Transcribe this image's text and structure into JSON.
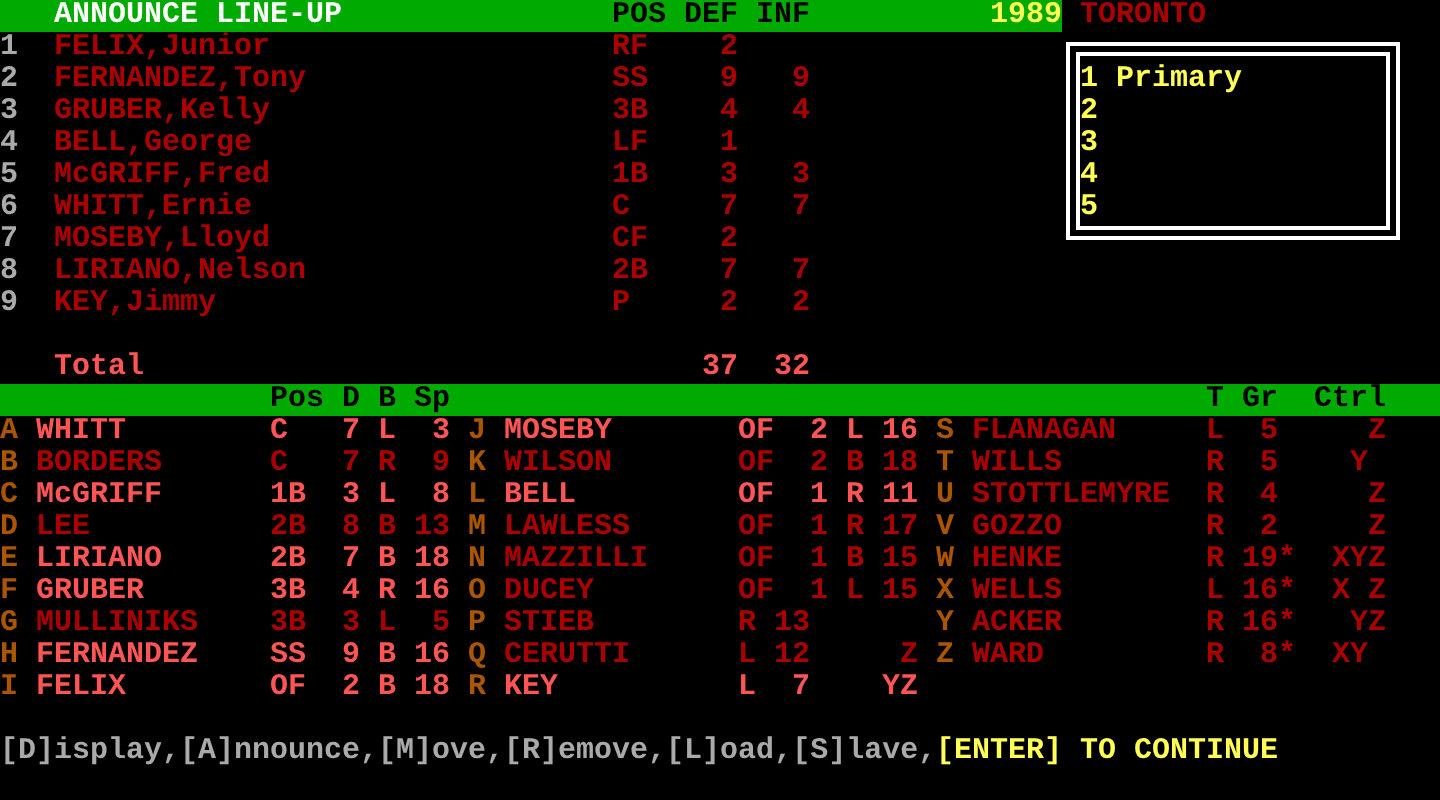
{
  "header": {
    "title": "ANNOUNCE LINE-UP",
    "columns": [
      "POS",
      "DEF",
      "INF"
    ],
    "year": "1989",
    "team": "TORONTO"
  },
  "lineup": [
    {
      "order": "1",
      "name": "FELIX,Junior",
      "pos": "RF",
      "def": "2"
    },
    {
      "order": "2",
      "name": "FERNANDEZ,Tony",
      "pos": "SS",
      "def": "9",
      "inf": "9"
    },
    {
      "order": "3",
      "name": "GRUBER,Kelly",
      "pos": "3B",
      "def": "4",
      "inf": "4"
    },
    {
      "order": "4",
      "name": "BELL,George",
      "pos": "LF",
      "def": "1"
    },
    {
      "order": "5",
      "name": "McGRIFF,Fred",
      "pos": "1B",
      "def": "3",
      "inf": "3"
    },
    {
      "order": "6",
      "name": "WHITT,Ernie",
      "pos": "C",
      "def": "7",
      "inf": "7"
    },
    {
      "order": "7",
      "name": "MOSEBY,Lloyd",
      "pos": "CF",
      "def": "2"
    },
    {
      "order": "8",
      "name": "LIRIANO,Nelson",
      "pos": "2B",
      "def": "7",
      "inf": "7"
    },
    {
      "order": "9",
      "name": "KEY,Jimmy",
      "pos": "P",
      "def": "2",
      "inf": "2"
    }
  ],
  "total": {
    "label": "Total",
    "def": "37",
    "inf": "32"
  },
  "slots": [
    {
      "number": "1",
      "name": "Primary"
    },
    {
      "number": "2"
    },
    {
      "number": "3"
    },
    {
      "number": "4"
    },
    {
      "number": "5"
    }
  ],
  "roster_columns": [
    "Pos",
    "D",
    "B",
    "Sp",
    "T",
    "Gr",
    "Ctrl"
  ],
  "roster": [
    {
      "kind": "batter",
      "key": "A",
      "name": "WHITT",
      "pos": "C",
      "d": "7",
      "b": "L",
      "sp": "3",
      "in_lineup": true
    },
    {
      "kind": "batter",
      "key": "B",
      "name": "BORDERS",
      "pos": "C",
      "d": "7",
      "b": "R",
      "sp": "9",
      "in_lineup": false
    },
    {
      "kind": "batter",
      "key": "C",
      "name": "McGRIFF",
      "pos": "1B",
      "d": "3",
      "b": "L",
      "sp": "8",
      "in_lineup": true
    },
    {
      "kind": "batter",
      "key": "D",
      "name": "LEE",
      "pos": "2B",
      "d": "8",
      "b": "B",
      "sp": "13",
      "in_lineup": false
    },
    {
      "kind": "batter",
      "key": "E",
      "name": "LIRIANO",
      "pos": "2B",
      "d": "7",
      "b": "B",
      "sp": "18",
      "in_lineup": true
    },
    {
      "kind": "batter",
      "key": "F",
      "name": "GRUBER",
      "pos": "3B",
      "d": "4",
      "b": "R",
      "sp": "16",
      "in_lineup": true
    },
    {
      "kind": "batter",
      "key": "G",
      "name": "MULLINIKS",
      "pos": "3B",
      "d": "3",
      "b": "L",
      "sp": "5",
      "in_lineup": false
    },
    {
      "kind": "batter",
      "key": "H",
      "name": "FERNANDEZ",
      "pos": "SS",
      "d": "9",
      "b": "B",
      "sp": "16",
      "in_lineup": true
    },
    {
      "kind": "batter",
      "key": "I",
      "name": "FELIX",
      "pos": "OF",
      "d": "2",
      "b": "B",
      "sp": "18",
      "in_lineup": true
    },
    {
      "kind": "batter",
      "key": "J",
      "name": "MOSEBY",
      "pos": "OF",
      "d": "2",
      "b": "L",
      "sp": "16",
      "in_lineup": true
    },
    {
      "kind": "batter",
      "key": "K",
      "name": "WILSON",
      "pos": "OF",
      "d": "2",
      "b": "B",
      "sp": "18",
      "in_lineup": false
    },
    {
      "kind": "batter",
      "key": "L",
      "name": "BELL",
      "pos": "OF",
      "d": "1",
      "b": "R",
      "sp": "11",
      "in_lineup": true
    },
    {
      "kind": "batter",
      "key": "M",
      "name": "LAWLESS",
      "pos": "OF",
      "d": "1",
      "b": "R",
      "sp": "17",
      "in_lineup": false
    },
    {
      "kind": "batter",
      "key": "N",
      "name": "MAZZILLI",
      "pos": "OF",
      "d": "1",
      "b": "B",
      "sp": "15",
      "in_lineup": false
    },
    {
      "kind": "batter",
      "key": "O",
      "name": "DUCEY",
      "pos": "OF",
      "d": "1",
      "b": "L",
      "sp": "15",
      "in_lineup": false
    },
    {
      "kind": "pitcher",
      "key": "P",
      "name": "STIEB",
      "t": "R",
      "gr": "13",
      "in_lineup": false
    },
    {
      "kind": "pitcher",
      "key": "Q",
      "name": "CERUTTI",
      "t": "L",
      "gr": "12",
      "ctrl": "  Z",
      "in_lineup": false
    },
    {
      "kind": "pitcher",
      "key": "R",
      "name": "KEY",
      "t": "L",
      "gr": "7",
      "ctrl": " YZ",
      "in_lineup": true
    },
    {
      "kind": "pitcher",
      "key": "S",
      "name": "FLANAGAN",
      "t": "L",
      "gr": "5",
      "ctrl": "  Z",
      "in_lineup": false
    },
    {
      "kind": "pitcher",
      "key": "T",
      "name": "WILLS",
      "t": "R",
      "gr": "5",
      "ctrl": " Y ",
      "in_lineup": false
    },
    {
      "kind": "pitcher",
      "key": "U",
      "name": "STOTTLEMYRE",
      "t": "R",
      "gr": "4",
      "ctrl": "  Z",
      "in_lineup": false
    },
    {
      "kind": "pitcher",
      "key": "V",
      "name": "GOZZO",
      "t": "R",
      "gr": "2",
      "ctrl": "  Z",
      "in_lineup": false
    },
    {
      "kind": "pitcher",
      "key": "W",
      "name": "HENKE",
      "t": "R",
      "gr": "19",
      "mark": "*",
      "ctrl": "XYZ",
      "in_lineup": false
    },
    {
      "kind": "pitcher",
      "key": "X",
      "name": "WELLS",
      "t": "L",
      "gr": "16",
      "mark": "*",
      "ctrl": "X Z",
      "in_lineup": false
    },
    {
      "kind": "pitcher",
      "key": "Y",
      "name": "ACKER",
      "t": "R",
      "gr": "16",
      "mark": "*",
      "ctrl": " YZ",
      "in_lineup": false
    },
    {
      "kind": "pitcher",
      "key": "Z",
      "name": "WARD",
      "t": "R",
      "gr": "8",
      "mark": "*",
      "ctrl": "XY ",
      "in_lineup": false
    }
  ],
  "footer": {
    "commands": "[D]isplay,[A]nnounce,[M]ove,[R]emove,[L]oad,[S]lave,",
    "prompt": "[ENTER] TO CONTINUE"
  }
}
